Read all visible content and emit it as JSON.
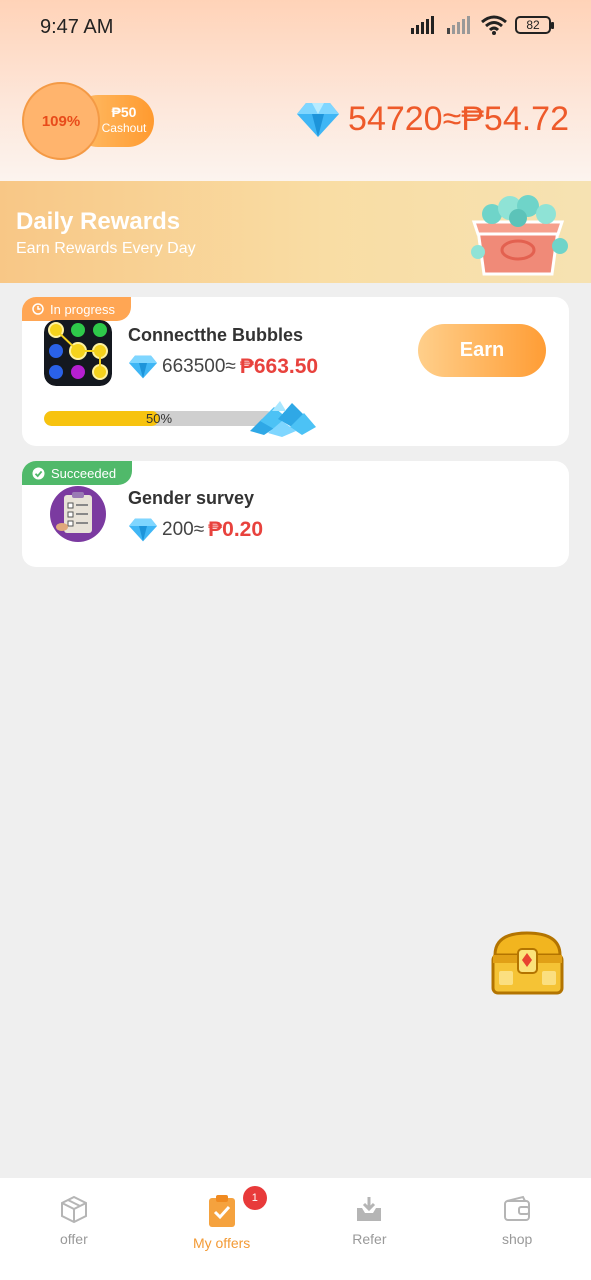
{
  "status_bar": {
    "time": "9:47 AM",
    "battery": "82"
  },
  "header": {
    "cashout_percent": "109%",
    "cashout_amount": "₱50",
    "cashout_label": "Cashout",
    "balance": "54720≈₱54.72"
  },
  "banner": {
    "title": "Daily Rewards",
    "subtitle": "Earn Rewards Every Day"
  },
  "offers": [
    {
      "status": "In progress",
      "title": "Connectthe Bubbles",
      "gems": "663500≈",
      "peso": "₱663.50",
      "action": "Earn",
      "progress_text": "50%",
      "progress_value": 0.5
    },
    {
      "status": "Succeeded",
      "title": "Gender survey",
      "gems": "200≈",
      "peso": "₱0.20"
    }
  ],
  "nav": {
    "items": [
      {
        "label": "offer",
        "icon": "box-icon"
      },
      {
        "label": "My offers",
        "icon": "clipboard-check-icon",
        "badge": "1"
      },
      {
        "label": "Refer",
        "icon": "inbox-download-icon"
      },
      {
        "label": "shop",
        "icon": "wallet-icon"
      }
    ],
    "active_index": 1
  },
  "colors": {
    "accent": "#ff9d35",
    "price_red": "#e8423d",
    "success_green": "#50b96a"
  }
}
